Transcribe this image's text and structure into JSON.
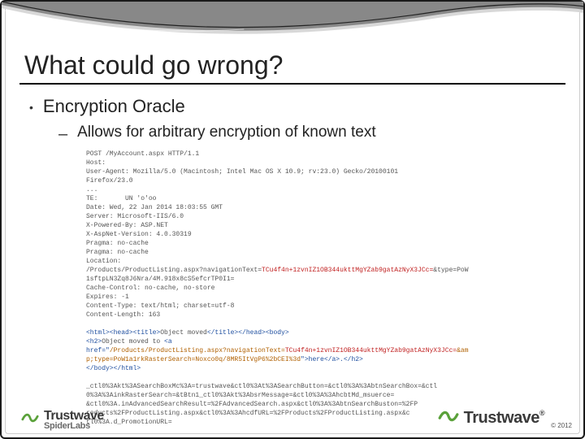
{
  "slide": {
    "title": "What could go wrong?",
    "bullet1": "Encryption Oracle",
    "bullet2": "Allows for arbitrary encryption of known text",
    "code_line_01": "POST /MyAccount.aspx HTTP/1.1",
    "code_line_02": "Host:",
    "code_line_03": "User-Agent: Mozilla/5.0 (Macintosh; Intel Mac OS X 10.9; rv:23.0) Gecko/20100101",
    "code_line_04": "Firefox/23.0",
    "code_line_05": "...",
    "code_line_05b": "TE:       UN 'o'oo",
    "code_line_06": "Date: Wed, 22 Jan 2014 18:03:55 GMT",
    "code_line_07": "Server: Microsoft-IIS/6.0",
    "code_line_08": "X-Powered-By: ASP.NET",
    "code_line_09": "X-AspNet-Version: 4.0.30319",
    "code_line_10": "Pragma: no-cache",
    "code_line_11": "Pragma: no-cache",
    "code_line_12": "Location:",
    "code_line_13a": "/Products/ProductListing.aspx?navigationText=",
    "code_line_13b": "TCu4f4n+1zvnIZ1OB344ukttMgYZab9gatAzNyX3JCc=",
    "code_line_13c": "&type=PoW",
    "code_line_14": "1sftpLN3Zq8J6Nra/4M.918x8cS5efcrTP0I1=",
    "code_line_15": "Cache-Control: no-cache, no-store",
    "code_line_16": "Expires: -1",
    "code_line_17": "Content-Type: text/html; charset=utf-8",
    "code_line_18": "Content-Length: 163",
    "code_line_19a": "<html><head><title>",
    "code_line_19b": "Object moved",
    "code_line_19c": "</title></head><body>",
    "code_line_20a": "<h2>",
    "code_line_20b": "Object moved to ",
    "code_line_20c": "<a",
    "code_line_21a": "href=\"",
    "code_line_21b": "/Products/ProductListing.aspx?navigationText=",
    "code_line_21c": "TCu4f4n+1zvnIZ1OB344ukttMgYZab9gatAzNyX3JCc=",
    "code_line_21d": "&am",
    "code_line_22a": "p;type=PoW1a",
    "code_line_22b": "1rkRasterSearch=Noxco0q/8MR5ItVgP6%2bCEI%3d",
    "code_line_22c": "\">here</a>.</h2>",
    "code_line_23": "</body></html>",
    "code_line_24": "_ctl0%3Akt%3ASearchBoxMc%3A=trustwave&ctl0%3At%3ASearchButton=&ctl0%3A%3AbtnSearchBox=&ctl",
    "code_line_25": "0%3A%3AinkRasterSearch=&tBtn1_ctl0%3Akt%3AbsrMessage=&ctl0%3A%3AhcbtMd_msuerce=",
    "code_line_26": "&ctl0%3A.inAdvancedSearchResult=%2FAdvancedSearch.aspx&ctl0%3A%3AbtnSearchBuston=%2FP",
    "code_line_27": "roducts%2FProductListing.aspx&ctl0%3A%3AhcdfURL=%2FProducts%2FProductListing.aspx&c",
    "code_line_28": "tl0%3A.d_PromotionURL="
  },
  "footer": {
    "left_main": "Trustwave",
    "left_sub": "SpiderLabs",
    "right_main": "Trustwave",
    "reg": "®",
    "copyright": "© 2012"
  }
}
